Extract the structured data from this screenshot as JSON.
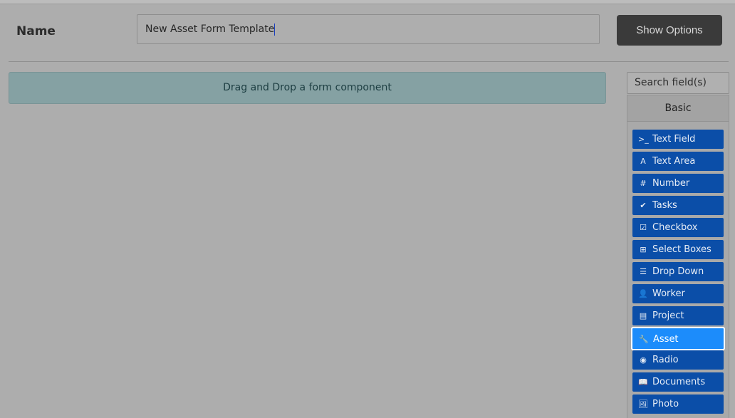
{
  "form": {
    "name_label": "Name",
    "name_value": "New Asset Form Template",
    "show_options_label": "Show Options",
    "drop_zone_text": "Drag and Drop a form component"
  },
  "sidebar": {
    "search_placeholder": "Search field(s)",
    "group_label": "Basic",
    "components": [
      {
        "label": "Text Field",
        "icon": "terminal-prompt-icon",
        "glyph": ">_"
      },
      {
        "label": "Text Area",
        "icon": "font-icon",
        "glyph": "A"
      },
      {
        "label": "Number",
        "icon": "hash-icon",
        "glyph": "#"
      },
      {
        "label": "Tasks",
        "icon": "check-circle-icon",
        "glyph": "✔"
      },
      {
        "label": "Checkbox",
        "icon": "check-square-icon",
        "glyph": "☑"
      },
      {
        "label": "Select Boxes",
        "icon": "plus-square-icon",
        "glyph": "⊞"
      },
      {
        "label": "Drop Down",
        "icon": "list-icon",
        "glyph": "☰"
      },
      {
        "label": "Worker",
        "icon": "user-icon",
        "glyph": "👤"
      },
      {
        "label": "Project",
        "icon": "building-icon",
        "glyph": "▤"
      },
      {
        "label": "Asset",
        "icon": "wrench-icon",
        "glyph": "🔧"
      },
      {
        "label": "Radio",
        "icon": "dot-circle-icon",
        "glyph": "◉"
      },
      {
        "label": "Documents",
        "icon": "book-icon",
        "glyph": "📖"
      },
      {
        "label": "Photo",
        "icon": "image-icon",
        "glyph": "🖼"
      }
    ],
    "active_component": "Asset"
  },
  "colors": {
    "component_button": "#0b4ea8",
    "component_button_active": "#1c8cfb",
    "show_options_button": "#3a3a3a",
    "drop_zone": "#85a1a3"
  }
}
